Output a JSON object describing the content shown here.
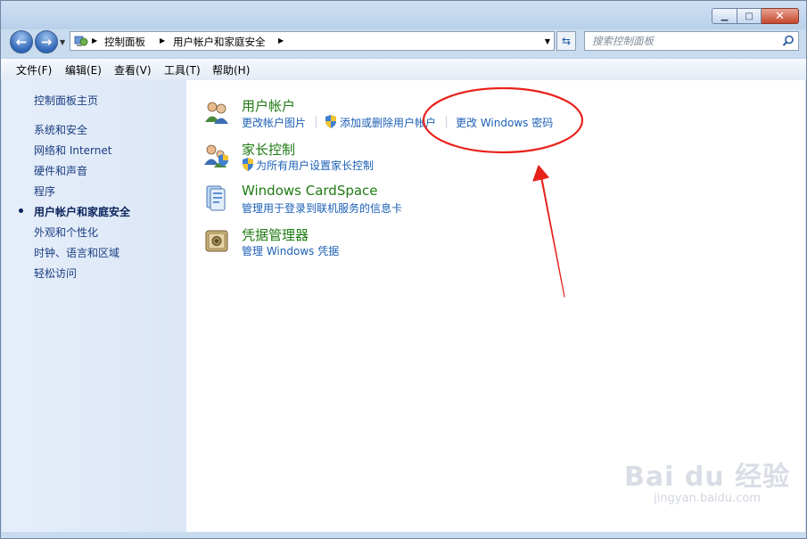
{
  "window": {
    "title": "",
    "min_icon": "minimize-icon",
    "max_icon": "maximize-icon",
    "close_icon": "close-icon"
  },
  "nav": {
    "back_icon": "back-arrow-icon",
    "forward_icon": "forward-arrow-icon",
    "breadcrumbs": [
      "控制面板",
      "用户帐户和家庭安全"
    ],
    "search_placeholder": "搜索控制面板"
  },
  "menu": [
    "文件(F)",
    "编辑(E)",
    "查看(V)",
    "工具(T)",
    "帮助(H)"
  ],
  "sidebar": {
    "home": "控制面板主页",
    "items": [
      "系统和安全",
      "网络和 Internet",
      "硬件和声音",
      "程序",
      "用户帐户和家庭安全",
      "外观和个性化",
      "时钟、语言和区域",
      "轻松访问"
    ],
    "selected_index": 4
  },
  "categories": [
    {
      "title": "用户帐户",
      "icon": "user-accounts-icon",
      "links": [
        "更改帐户图片",
        "添加或删除用户帐户",
        "更改 Windows 密码"
      ]
    },
    {
      "title": "家长控制",
      "icon": "parental-controls-icon",
      "links": [
        "为所有用户设置家长控制"
      ]
    },
    {
      "title": "Windows CardSpace",
      "icon": "cardspace-icon",
      "links": [
        "管理用于登录到联机服务的信息卡"
      ]
    },
    {
      "title": "凭据管理器",
      "icon": "credential-manager-icon",
      "links": [
        "管理 Windows 凭据"
      ]
    }
  ],
  "annotation": {
    "color": "#e8231c"
  },
  "watermark": {
    "line1": "Bai du 经验",
    "line2": "jingyan.baidu.com"
  }
}
